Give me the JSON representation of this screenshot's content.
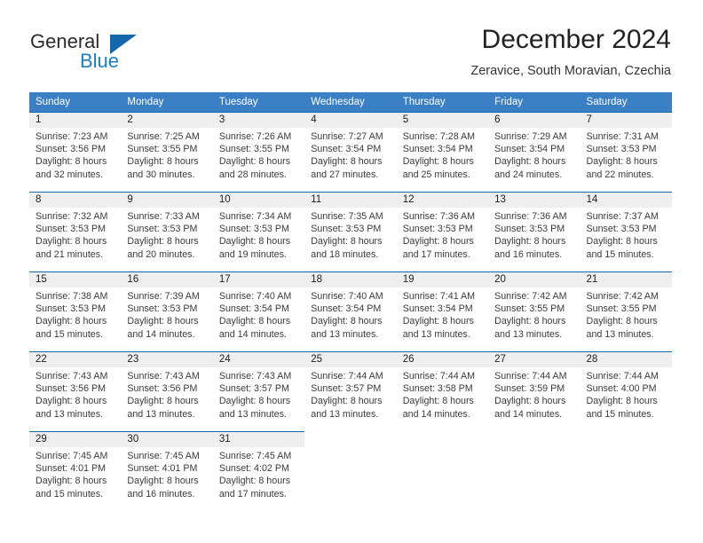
{
  "brand": {
    "name_top": "General",
    "name_bottom": "Blue",
    "triangle_color": "#1567ab",
    "blue_color": "#1a7fc1"
  },
  "header": {
    "title": "December 2024",
    "subtitle": "Zeravice, South Moravian, Czechia"
  },
  "theme": {
    "header_bg": "#3b7fc4",
    "row_rule": "#1567ab",
    "daynum_bg": "#efefef"
  },
  "weekdays": [
    "Sunday",
    "Monday",
    "Tuesday",
    "Wednesday",
    "Thursday",
    "Friday",
    "Saturday"
  ],
  "weeks": [
    [
      {
        "day": "1",
        "sunrise": "Sunrise: 7:23 AM",
        "sunset": "Sunset: 3:56 PM",
        "daylight1": "Daylight: 8 hours",
        "daylight2": "and 32 minutes."
      },
      {
        "day": "2",
        "sunrise": "Sunrise: 7:25 AM",
        "sunset": "Sunset: 3:55 PM",
        "daylight1": "Daylight: 8 hours",
        "daylight2": "and 30 minutes."
      },
      {
        "day": "3",
        "sunrise": "Sunrise: 7:26 AM",
        "sunset": "Sunset: 3:55 PM",
        "daylight1": "Daylight: 8 hours",
        "daylight2": "and 28 minutes."
      },
      {
        "day": "4",
        "sunrise": "Sunrise: 7:27 AM",
        "sunset": "Sunset: 3:54 PM",
        "daylight1": "Daylight: 8 hours",
        "daylight2": "and 27 minutes."
      },
      {
        "day": "5",
        "sunrise": "Sunrise: 7:28 AM",
        "sunset": "Sunset: 3:54 PM",
        "daylight1": "Daylight: 8 hours",
        "daylight2": "and 25 minutes."
      },
      {
        "day": "6",
        "sunrise": "Sunrise: 7:29 AM",
        "sunset": "Sunset: 3:54 PM",
        "daylight1": "Daylight: 8 hours",
        "daylight2": "and 24 minutes."
      },
      {
        "day": "7",
        "sunrise": "Sunrise: 7:31 AM",
        "sunset": "Sunset: 3:53 PM",
        "daylight1": "Daylight: 8 hours",
        "daylight2": "and 22 minutes."
      }
    ],
    [
      {
        "day": "8",
        "sunrise": "Sunrise: 7:32 AM",
        "sunset": "Sunset: 3:53 PM",
        "daylight1": "Daylight: 8 hours",
        "daylight2": "and 21 minutes."
      },
      {
        "day": "9",
        "sunrise": "Sunrise: 7:33 AM",
        "sunset": "Sunset: 3:53 PM",
        "daylight1": "Daylight: 8 hours",
        "daylight2": "and 20 minutes."
      },
      {
        "day": "10",
        "sunrise": "Sunrise: 7:34 AM",
        "sunset": "Sunset: 3:53 PM",
        "daylight1": "Daylight: 8 hours",
        "daylight2": "and 19 minutes."
      },
      {
        "day": "11",
        "sunrise": "Sunrise: 7:35 AM",
        "sunset": "Sunset: 3:53 PM",
        "daylight1": "Daylight: 8 hours",
        "daylight2": "and 18 minutes."
      },
      {
        "day": "12",
        "sunrise": "Sunrise: 7:36 AM",
        "sunset": "Sunset: 3:53 PM",
        "daylight1": "Daylight: 8 hours",
        "daylight2": "and 17 minutes."
      },
      {
        "day": "13",
        "sunrise": "Sunrise: 7:36 AM",
        "sunset": "Sunset: 3:53 PM",
        "daylight1": "Daylight: 8 hours",
        "daylight2": "and 16 minutes."
      },
      {
        "day": "14",
        "sunrise": "Sunrise: 7:37 AM",
        "sunset": "Sunset: 3:53 PM",
        "daylight1": "Daylight: 8 hours",
        "daylight2": "and 15 minutes."
      }
    ],
    [
      {
        "day": "15",
        "sunrise": "Sunrise: 7:38 AM",
        "sunset": "Sunset: 3:53 PM",
        "daylight1": "Daylight: 8 hours",
        "daylight2": "and 15 minutes."
      },
      {
        "day": "16",
        "sunrise": "Sunrise: 7:39 AM",
        "sunset": "Sunset: 3:53 PM",
        "daylight1": "Daylight: 8 hours",
        "daylight2": "and 14 minutes."
      },
      {
        "day": "17",
        "sunrise": "Sunrise: 7:40 AM",
        "sunset": "Sunset: 3:54 PM",
        "daylight1": "Daylight: 8 hours",
        "daylight2": "and 14 minutes."
      },
      {
        "day": "18",
        "sunrise": "Sunrise: 7:40 AM",
        "sunset": "Sunset: 3:54 PM",
        "daylight1": "Daylight: 8 hours",
        "daylight2": "and 13 minutes."
      },
      {
        "day": "19",
        "sunrise": "Sunrise: 7:41 AM",
        "sunset": "Sunset: 3:54 PM",
        "daylight1": "Daylight: 8 hours",
        "daylight2": "and 13 minutes."
      },
      {
        "day": "20",
        "sunrise": "Sunrise: 7:42 AM",
        "sunset": "Sunset: 3:55 PM",
        "daylight1": "Daylight: 8 hours",
        "daylight2": "and 13 minutes."
      },
      {
        "day": "21",
        "sunrise": "Sunrise: 7:42 AM",
        "sunset": "Sunset: 3:55 PM",
        "daylight1": "Daylight: 8 hours",
        "daylight2": "and 13 minutes."
      }
    ],
    [
      {
        "day": "22",
        "sunrise": "Sunrise: 7:43 AM",
        "sunset": "Sunset: 3:56 PM",
        "daylight1": "Daylight: 8 hours",
        "daylight2": "and 13 minutes."
      },
      {
        "day": "23",
        "sunrise": "Sunrise: 7:43 AM",
        "sunset": "Sunset: 3:56 PM",
        "daylight1": "Daylight: 8 hours",
        "daylight2": "and 13 minutes."
      },
      {
        "day": "24",
        "sunrise": "Sunrise: 7:43 AM",
        "sunset": "Sunset: 3:57 PM",
        "daylight1": "Daylight: 8 hours",
        "daylight2": "and 13 minutes."
      },
      {
        "day": "25",
        "sunrise": "Sunrise: 7:44 AM",
        "sunset": "Sunset: 3:57 PM",
        "daylight1": "Daylight: 8 hours",
        "daylight2": "and 13 minutes."
      },
      {
        "day": "26",
        "sunrise": "Sunrise: 7:44 AM",
        "sunset": "Sunset: 3:58 PM",
        "daylight1": "Daylight: 8 hours",
        "daylight2": "and 14 minutes."
      },
      {
        "day": "27",
        "sunrise": "Sunrise: 7:44 AM",
        "sunset": "Sunset: 3:59 PM",
        "daylight1": "Daylight: 8 hours",
        "daylight2": "and 14 minutes."
      },
      {
        "day": "28",
        "sunrise": "Sunrise: 7:44 AM",
        "sunset": "Sunset: 4:00 PM",
        "daylight1": "Daylight: 8 hours",
        "daylight2": "and 15 minutes."
      }
    ],
    [
      {
        "day": "29",
        "sunrise": "Sunrise: 7:45 AM",
        "sunset": "Sunset: 4:01 PM",
        "daylight1": "Daylight: 8 hours",
        "daylight2": "and 15 minutes."
      },
      {
        "day": "30",
        "sunrise": "Sunrise: 7:45 AM",
        "sunset": "Sunset: 4:01 PM",
        "daylight1": "Daylight: 8 hours",
        "daylight2": "and 16 minutes."
      },
      {
        "day": "31",
        "sunrise": "Sunrise: 7:45 AM",
        "sunset": "Sunset: 4:02 PM",
        "daylight1": "Daylight: 8 hours",
        "daylight2": "and 17 minutes."
      },
      {
        "day": "",
        "sunrise": "",
        "sunset": "",
        "daylight1": "",
        "daylight2": ""
      },
      {
        "day": "",
        "sunrise": "",
        "sunset": "",
        "daylight1": "",
        "daylight2": ""
      },
      {
        "day": "",
        "sunrise": "",
        "sunset": "",
        "daylight1": "",
        "daylight2": ""
      },
      {
        "day": "",
        "sunrise": "",
        "sunset": "",
        "daylight1": "",
        "daylight2": ""
      }
    ]
  ]
}
